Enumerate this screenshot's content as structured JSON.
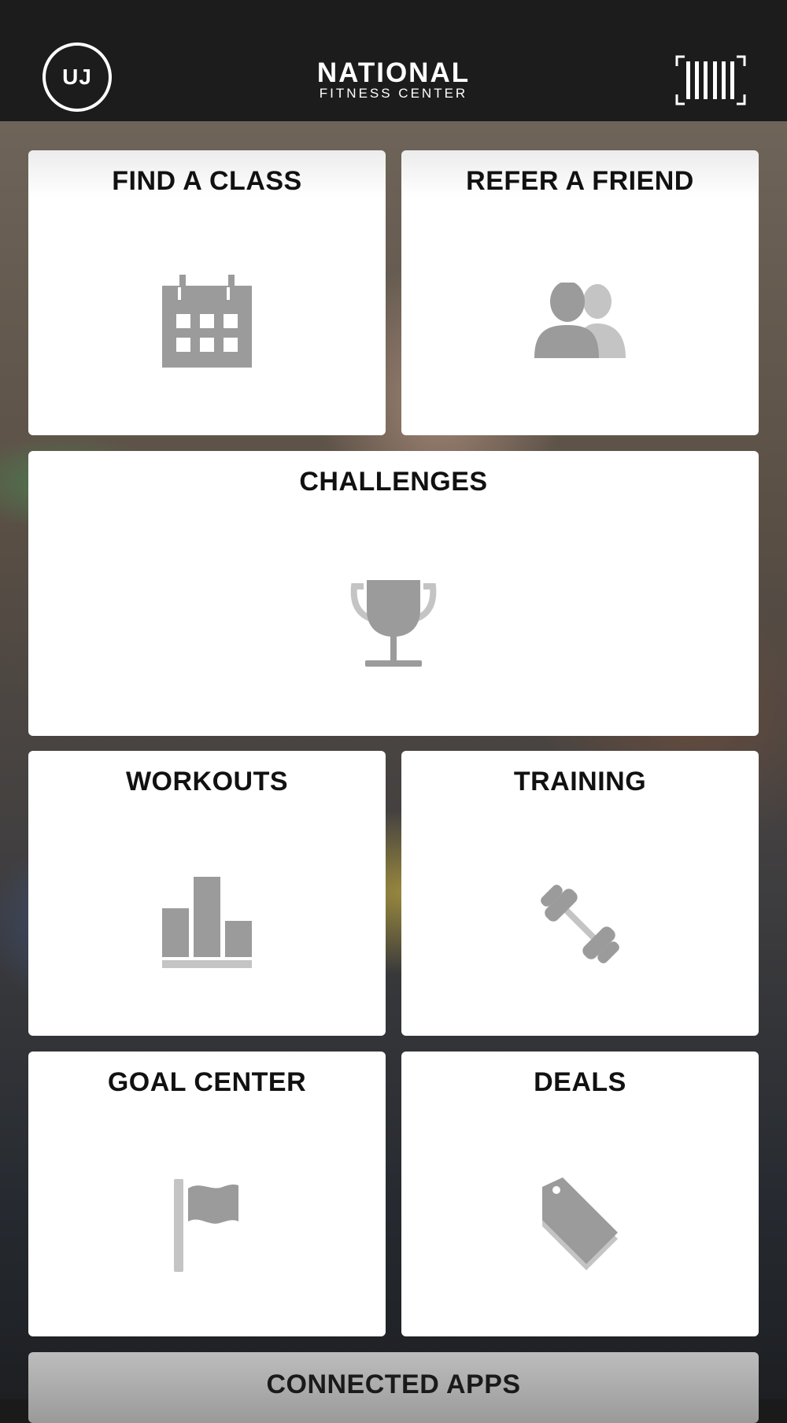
{
  "header": {
    "avatar_initials": "UJ",
    "logo_main": "NATIONAL",
    "logo_sub": "FITNESS CENTER"
  },
  "tiles": {
    "find_class": {
      "label": "FIND A CLASS",
      "icon": "calendar-icon"
    },
    "refer_friend": {
      "label": "REFER A FRIEND",
      "icon": "users-icon"
    },
    "challenges": {
      "label": "CHALLENGES",
      "icon": "trophy-icon"
    },
    "workouts": {
      "label": "WORKOUTS",
      "icon": "bar-chart-icon"
    },
    "training": {
      "label": "TRAINING",
      "icon": "dumbbell-icon"
    },
    "goal_center": {
      "label": "GOAL CENTER",
      "icon": "flag-icon"
    },
    "deals": {
      "label": "DEALS",
      "icon": "tag-icon"
    },
    "connected_apps": {
      "label": "CONNECTED APPS"
    }
  },
  "colors": {
    "header_bg": "#1c1c1c",
    "tile_bg": "#ffffff",
    "icon_gray": "#9b9b9b",
    "icon_light_gray": "#c4c4c4",
    "label_text": "#111111"
  }
}
